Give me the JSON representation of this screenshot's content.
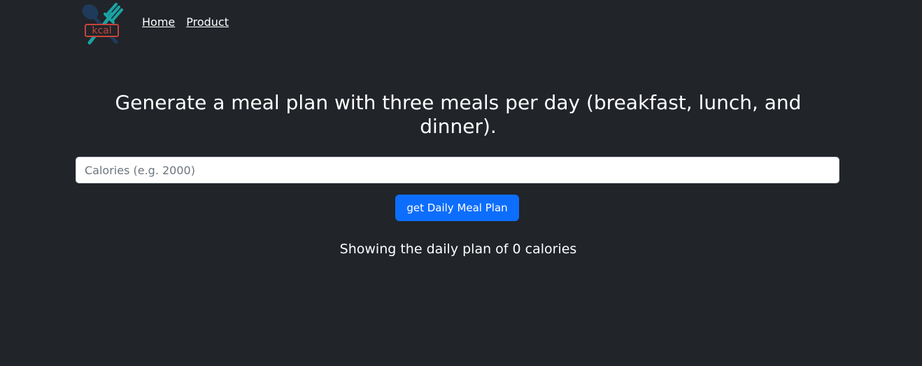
{
  "nav": {
    "logo_text": "kcal",
    "links": [
      {
        "label": "Home"
      },
      {
        "label": "Product"
      }
    ]
  },
  "main": {
    "headline": "Generate a meal plan with three meals per day (breakfast, lunch, and dinner).",
    "calories_input": {
      "value": "",
      "placeholder": "Calories (e.g. 2000)"
    },
    "submit_label": "get Daily Meal Plan",
    "result_text": "Showing the daily plan of 0 calories"
  },
  "colors": {
    "background": "#212429",
    "primary_button": "#0d6efd",
    "logo_accent": "#c7443a",
    "logo_teal": "#1aa3a3",
    "logo_navy": "#1f3b5c"
  },
  "icons": {
    "logo": "kcal-fork-spoon-logo"
  }
}
